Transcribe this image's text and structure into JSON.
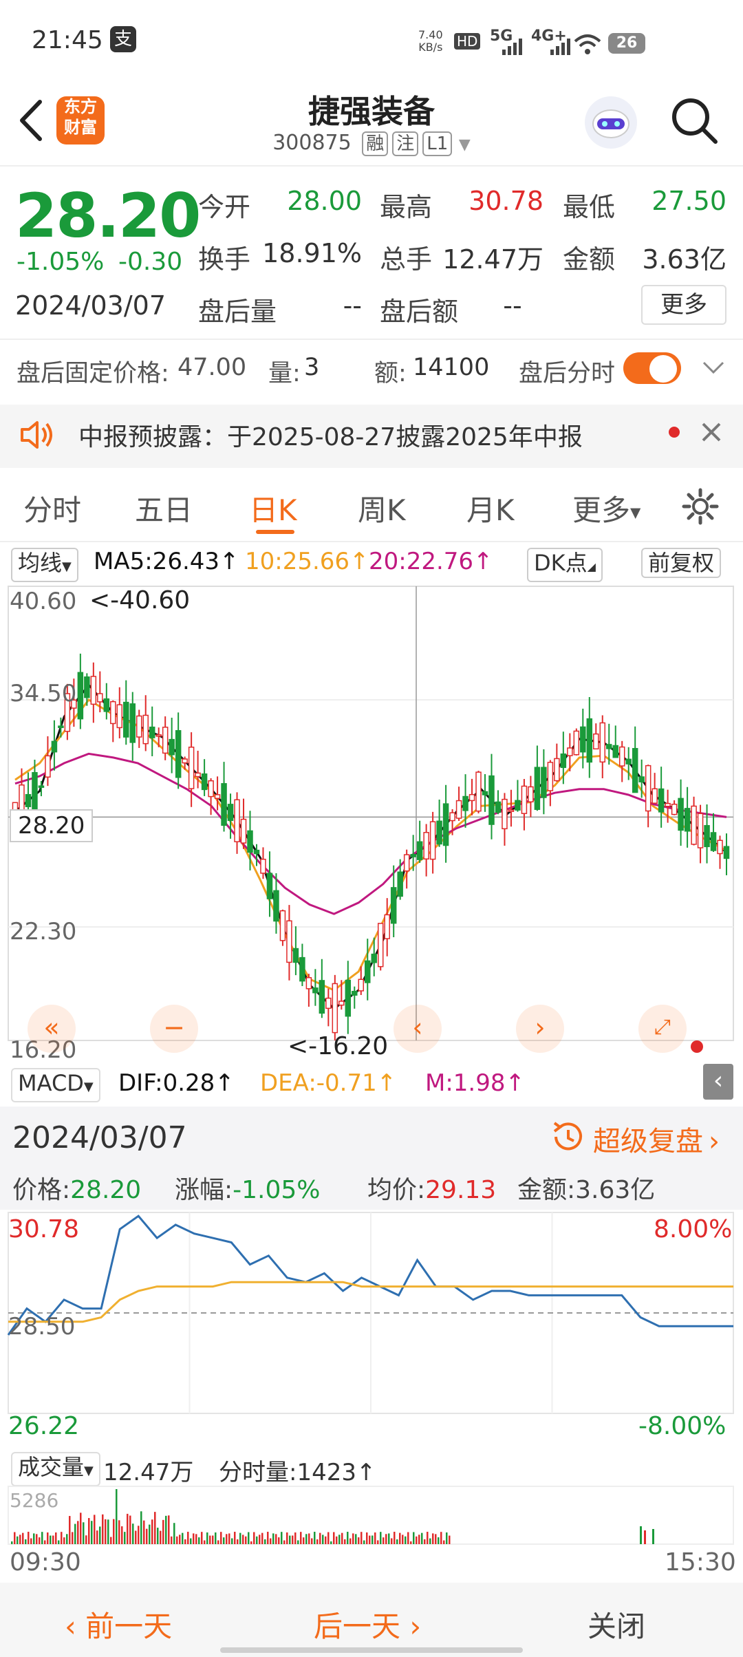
{
  "status_bar": {
    "time": "21:45",
    "alipay_icon": "支",
    "net_speed_top": "7.40",
    "net_speed_bottom": "KB/s",
    "hd": "HD",
    "sim1": "5G",
    "sim2": "4G+",
    "battery": "26"
  },
  "nav": {
    "logo_line1": "东方",
    "logo_line2": "财富",
    "title": "捷强装备",
    "code": "300875",
    "tag_rong": "融",
    "tag_zhu": "注",
    "tag_l1": "L1"
  },
  "quote": {
    "price": "28.20",
    "change_pct": "-1.05%",
    "change_amt": "-0.30",
    "date": "2024/03/07",
    "open_label": "今开",
    "open": "28.00",
    "high_label": "最高",
    "high": "30.78",
    "low_label": "最低",
    "low": "27.50",
    "turnover_rate_label": "换手",
    "turnover_rate": "18.91%",
    "volume_label": "总手",
    "volume": "12.47万",
    "amount_label": "金额",
    "amount": "3.63亿",
    "ah_volume_label": "盘后量",
    "ah_volume": "--",
    "ah_amount_label": "盘后额",
    "ah_amount": "--",
    "more_label": "更多"
  },
  "after_hours": {
    "fixed_price_label": "盘后固定价格:",
    "fixed_price": "47.00",
    "qty_label": "量:",
    "qty": "3",
    "amt_label": "额:",
    "amt": "14100",
    "timeshare_label": "盘后分时"
  },
  "notice": {
    "text": "中报预披露：于2025-08-27披露2025年中报"
  },
  "tabs": [
    {
      "label": "分时"
    },
    {
      "label": "五日"
    },
    {
      "label": "日K"
    },
    {
      "label": "周K"
    },
    {
      "label": "月K"
    },
    {
      "label": "更多"
    }
  ],
  "kline_header": {
    "indicator": "均线",
    "ma5": "MA5:26.43↑",
    "ma10": "10:25.66↑",
    "ma20": "20:22.76↑",
    "dk": "DK点",
    "fq": "前复权"
  },
  "kline_axis": {
    "y_top": "40.60",
    "y_2": "34.50",
    "y_cur": "28.20",
    "y_3": "22.30",
    "y_bottom": "16.20",
    "max_note": "<-40.60",
    "min_note": "<-16.20"
  },
  "macd": {
    "name": "MACD",
    "dif": "DIF:0.28↑",
    "dea": "DEA:-0.71↑",
    "m": "M:1.98↑"
  },
  "detail": {
    "date": "2024/03/07",
    "super_review": "超级复盘",
    "price_label": "价格:",
    "price": "28.20",
    "pct_label": "涨幅:",
    "pct": "-1.05%",
    "avg_label": "均价:",
    "avg": "29.13",
    "amount_label": "金额:",
    "amount": "3.63亿"
  },
  "intraday_axis": {
    "y_top": "30.78",
    "y_mid": "28.50",
    "y_bottom": "26.22",
    "pct_top": "8.00%",
    "pct_bottom": "-8.00%",
    "t_start": "09:30",
    "t_end": "15:30"
  },
  "volume": {
    "label": "成交量",
    "total": "12.47万",
    "tick_label": "分时量:1423↑",
    "max": "5286"
  },
  "bottom_bar": {
    "prev": "前一天",
    "next": "后一天",
    "close": "关闭"
  },
  "colors": {
    "up": "#e02a2a",
    "down": "#1a9a3a",
    "accent": "#f36b1b",
    "ma5": "#111111",
    "ma10": "#f0a020",
    "ma20": "#c0187f",
    "intraday": "#2e6fb0"
  },
  "chart_data": {
    "type": "line",
    "kline_ma": {
      "series": [
        {
          "name": "MA5",
          "values": [
            28.5,
            29.6,
            33.6,
            35.3,
            33.8,
            33.1,
            32.5,
            31.1,
            29.7,
            28.1,
            26.0,
            22.0,
            19.2,
            17.9,
            18.9,
            21.6,
            25.9,
            26.9,
            28.5,
            29.7,
            28.3,
            29.4,
            30.6,
            32.4,
            32.2,
            31.2,
            29.4,
            28.5,
            27.4,
            26.3
          ]
        },
        {
          "name": "MA10",
          "values": [
            30.2,
            31.1,
            32.8,
            34.5,
            33.7,
            33.1,
            31.9,
            30.7,
            29.6,
            27.5,
            24.8,
            21.9,
            19.5,
            18.9,
            19.9,
            22.6,
            25.3,
            26.4,
            27.7,
            28.8,
            28.9,
            29.0,
            29.9,
            31.4,
            31.5,
            30.6,
            28.8,
            27.9,
            27.1,
            26.4
          ]
        },
        {
          "name": "MA20",
          "values": [
            30.0,
            30.4,
            31.1,
            31.6,
            31.4,
            31.1,
            30.4,
            29.7,
            28.8,
            27.2,
            25.7,
            24.4,
            23.5,
            23.0,
            23.6,
            24.6,
            26.0,
            26.9,
            27.6,
            28.1,
            28.6,
            29.1,
            29.5,
            29.7,
            29.7,
            29.4,
            28.9,
            28.6,
            28.4,
            28.2
          ]
        }
      ]
    },
    "intraday": {
      "series": [
        {
          "name": "价格",
          "values": [
            28.0,
            28.6,
            28.3,
            28.8,
            28.6,
            28.6,
            30.4,
            30.7,
            30.2,
            30.5,
            30.3,
            30.2,
            30.1,
            29.6,
            29.8,
            29.3,
            29.2,
            29.4,
            29.0,
            29.3,
            29.1,
            28.9,
            29.7,
            29.1,
            29.1,
            28.8,
            29.0,
            29.0,
            28.9,
            28.9,
            28.9,
            28.9,
            28.9,
            28.9,
            28.4,
            28.2,
            28.2,
            28.2,
            28.2,
            28.2
          ]
        },
        {
          "name": "均价",
          "values": [
            28.3,
            28.3,
            28.3,
            28.3,
            28.3,
            28.4,
            28.8,
            29.0,
            29.1,
            29.1,
            29.1,
            29.1,
            29.2,
            29.2,
            29.2,
            29.2,
            29.2,
            29.2,
            29.2,
            29.1,
            29.1,
            29.1,
            29.1,
            29.1,
            29.1,
            29.1,
            29.1,
            29.1,
            29.1,
            29.1,
            29.1,
            29.1,
            29.1,
            29.1,
            29.1,
            29.1,
            29.1,
            29.1,
            29.1,
            29.1
          ]
        }
      ]
    }
  }
}
